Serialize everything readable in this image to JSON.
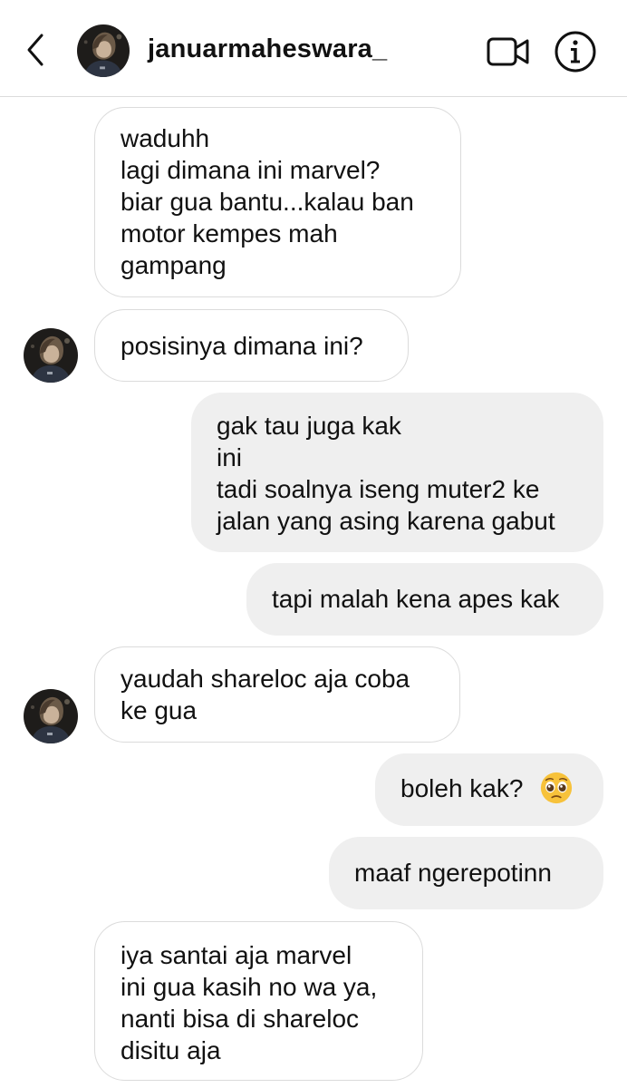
{
  "header": {
    "username": "januarmaheswara_",
    "back_icon": "chevron-left-icon",
    "video_icon": "video-camera-icon",
    "info_icon": "info-icon"
  },
  "messages": [
    {
      "from": "them",
      "lines": [
        "waduhh",
        "lagi dimana ini marvel?",
        "biar gua bantu...kalau ban",
        "motor kempes mah",
        "gampang"
      ]
    },
    {
      "from": "them",
      "lines": [
        "posisinya dimana ini?"
      ]
    },
    {
      "from": "me",
      "lines": [
        "gak tau juga kak",
        "ini",
        "tadi soalnya iseng muter2 ke",
        "jalan yang asing karena gabut"
      ]
    },
    {
      "from": "me",
      "lines": [
        "tapi malah kena apes kak"
      ]
    },
    {
      "from": "them",
      "lines": [
        "yaudah shareloc aja coba",
        "ke gua"
      ]
    },
    {
      "from": "me",
      "lines": [
        "boleh kak?"
      ],
      "emoji": "pleading-face-emoji"
    },
    {
      "from": "me",
      "lines": [
        "maaf ngerepotinn"
      ]
    },
    {
      "from": "them",
      "lines": [
        "iya santai aja marvel",
        "ini gua kasih no wa ya,",
        "nanti bisa di shareloc",
        "disitu aja"
      ]
    }
  ],
  "colors": {
    "incoming_bg": "#ffffff",
    "incoming_border": "#dbdbdb",
    "outgoing_bg": "#efefef",
    "text": "#111111"
  }
}
